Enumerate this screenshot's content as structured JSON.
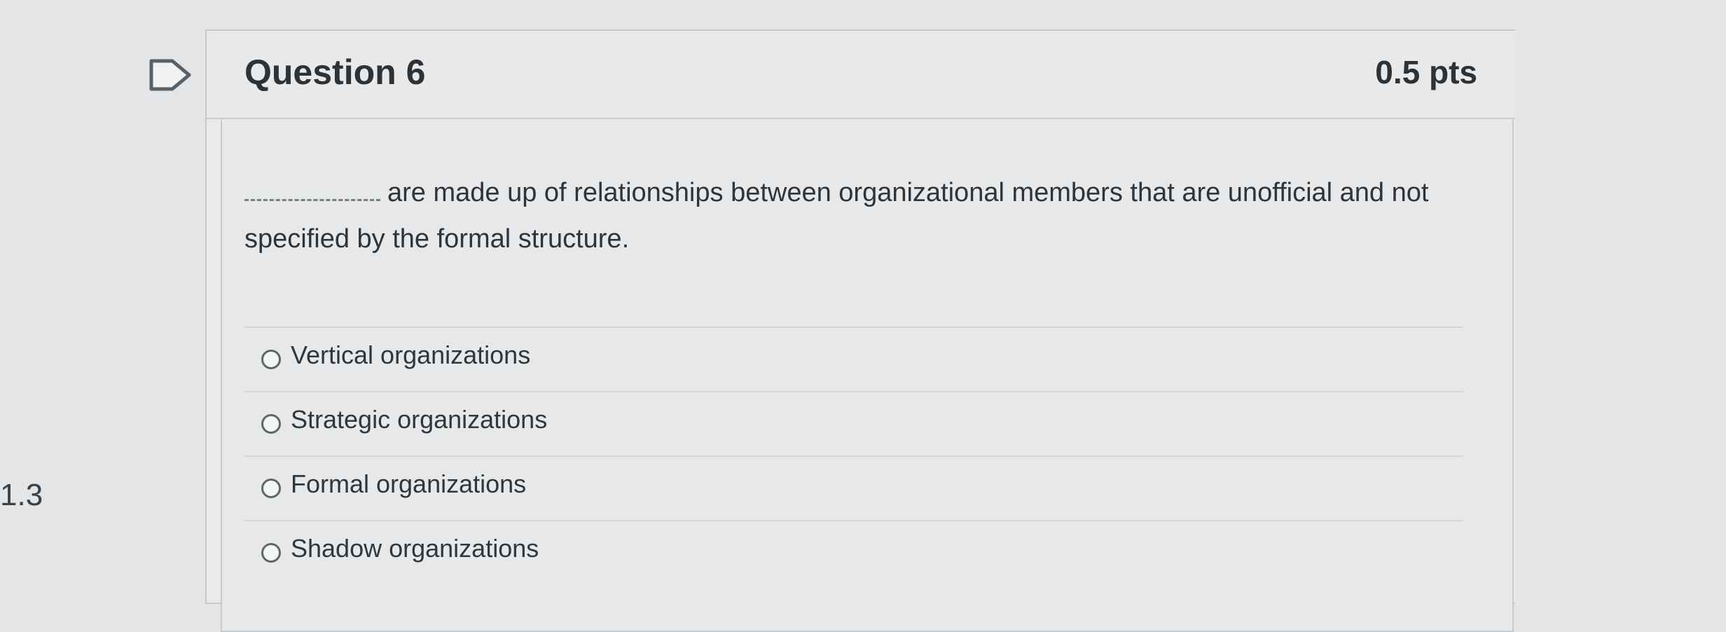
{
  "page": {
    "side_number": "1.3"
  },
  "question": {
    "title": "Question 6",
    "points": "0.5 pts",
    "text_after_blank": "are made up of relationships between organizational members that are unofficial and not specified by the formal structure.",
    "answers": [
      {
        "label": "Vertical organizations"
      },
      {
        "label": "Strategic organizations"
      },
      {
        "label": "Formal organizations"
      },
      {
        "label": "Shadow organizations"
      }
    ]
  }
}
